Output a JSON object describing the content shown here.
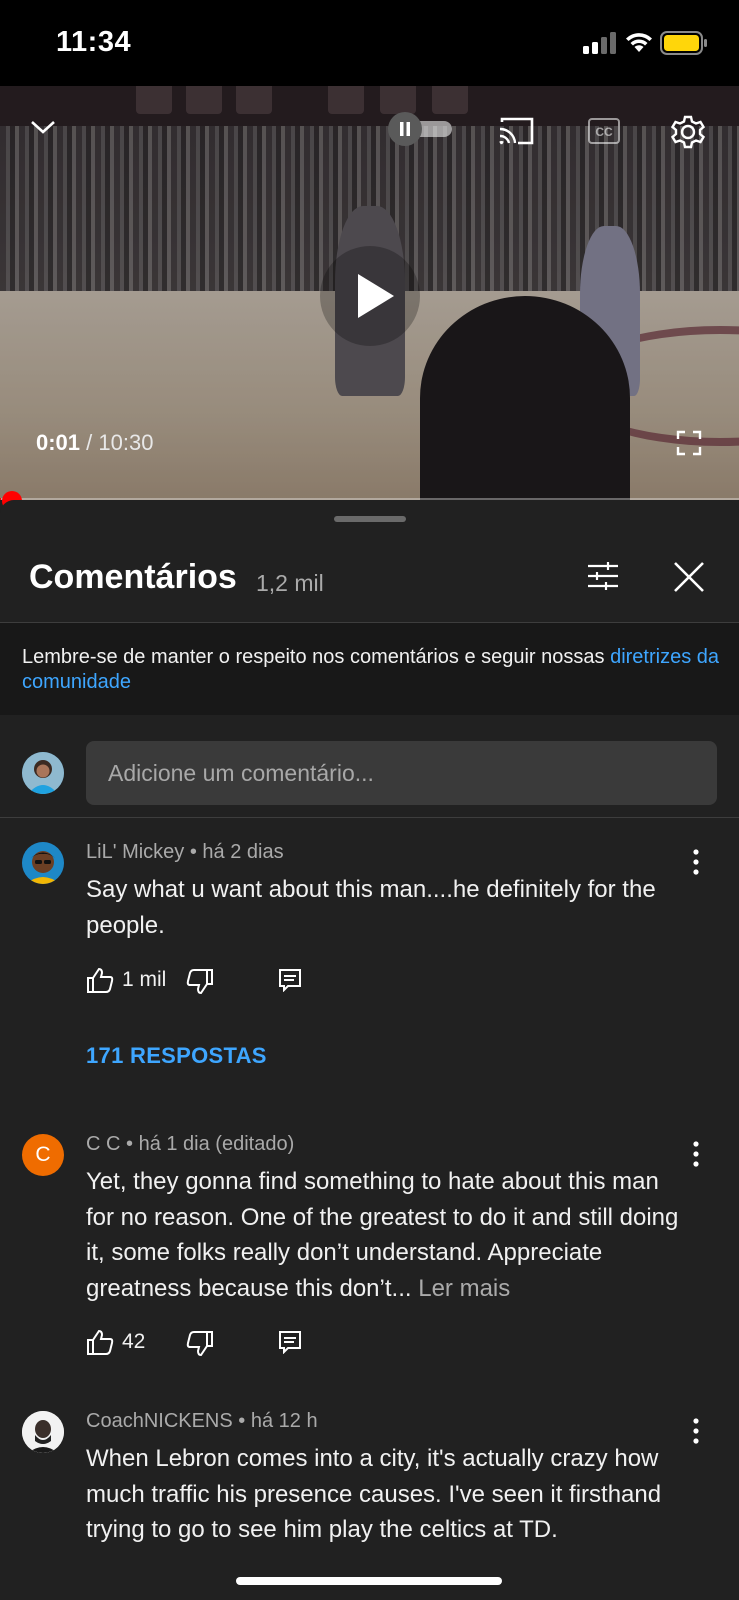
{
  "status_bar": {
    "time": "11:34"
  },
  "video": {
    "current_time": "0:01",
    "separator": " / ",
    "duration": "10:30",
    "progress_fraction": 0.0016
  },
  "comments_panel": {
    "title": "Comentários",
    "count": "1,2 mil",
    "notice_text": "Lembre-se de manter o respeito nos comentários e seguir nossas ",
    "notice_link": "diretrizes da comunidade",
    "input_placeholder": "Adicione um comentário...",
    "comments": [
      {
        "author": "LiL' Mickey",
        "time": "há 2 dias",
        "text": "Say what u want about this man....he definitely for the people.",
        "likes": "1 mil",
        "replies_label": "171 RESPOSTAS"
      },
      {
        "author": "C C",
        "avatar_letter": "C",
        "avatar_color": "#ef6c00",
        "time": "há 1 dia (editado)",
        "text": "Yet, they gonna find something to hate about this man for no reason. One of the greatest to do it and still doing it, some folks really don’t understand. Appreciate greatness because this don’t...",
        "read_more": "Ler mais",
        "likes": "42"
      },
      {
        "author": "CoachNICKENS",
        "time": "há 12 h",
        "text": "When Lebron comes into a city, it's actually crazy how much traffic his presence causes. I've seen it firsthand trying to go to see him play the celtics at TD."
      }
    ]
  },
  "colors": {
    "background": "#212121",
    "link": "#3ea6ff",
    "progress": "#ff0000",
    "battery": "#ffd60a"
  },
  "icons": [
    "signal-icon",
    "wifi-icon",
    "battery-icon",
    "chevron-down-icon",
    "autoplay-toggle-icon",
    "cast-icon",
    "closed-captions-icon",
    "settings-gear-icon",
    "play-icon",
    "fullscreen-icon",
    "filter-sliders-icon",
    "close-icon",
    "more-vert-icon",
    "thumb-up-icon",
    "thumb-down-icon",
    "reply-comment-icon"
  ]
}
